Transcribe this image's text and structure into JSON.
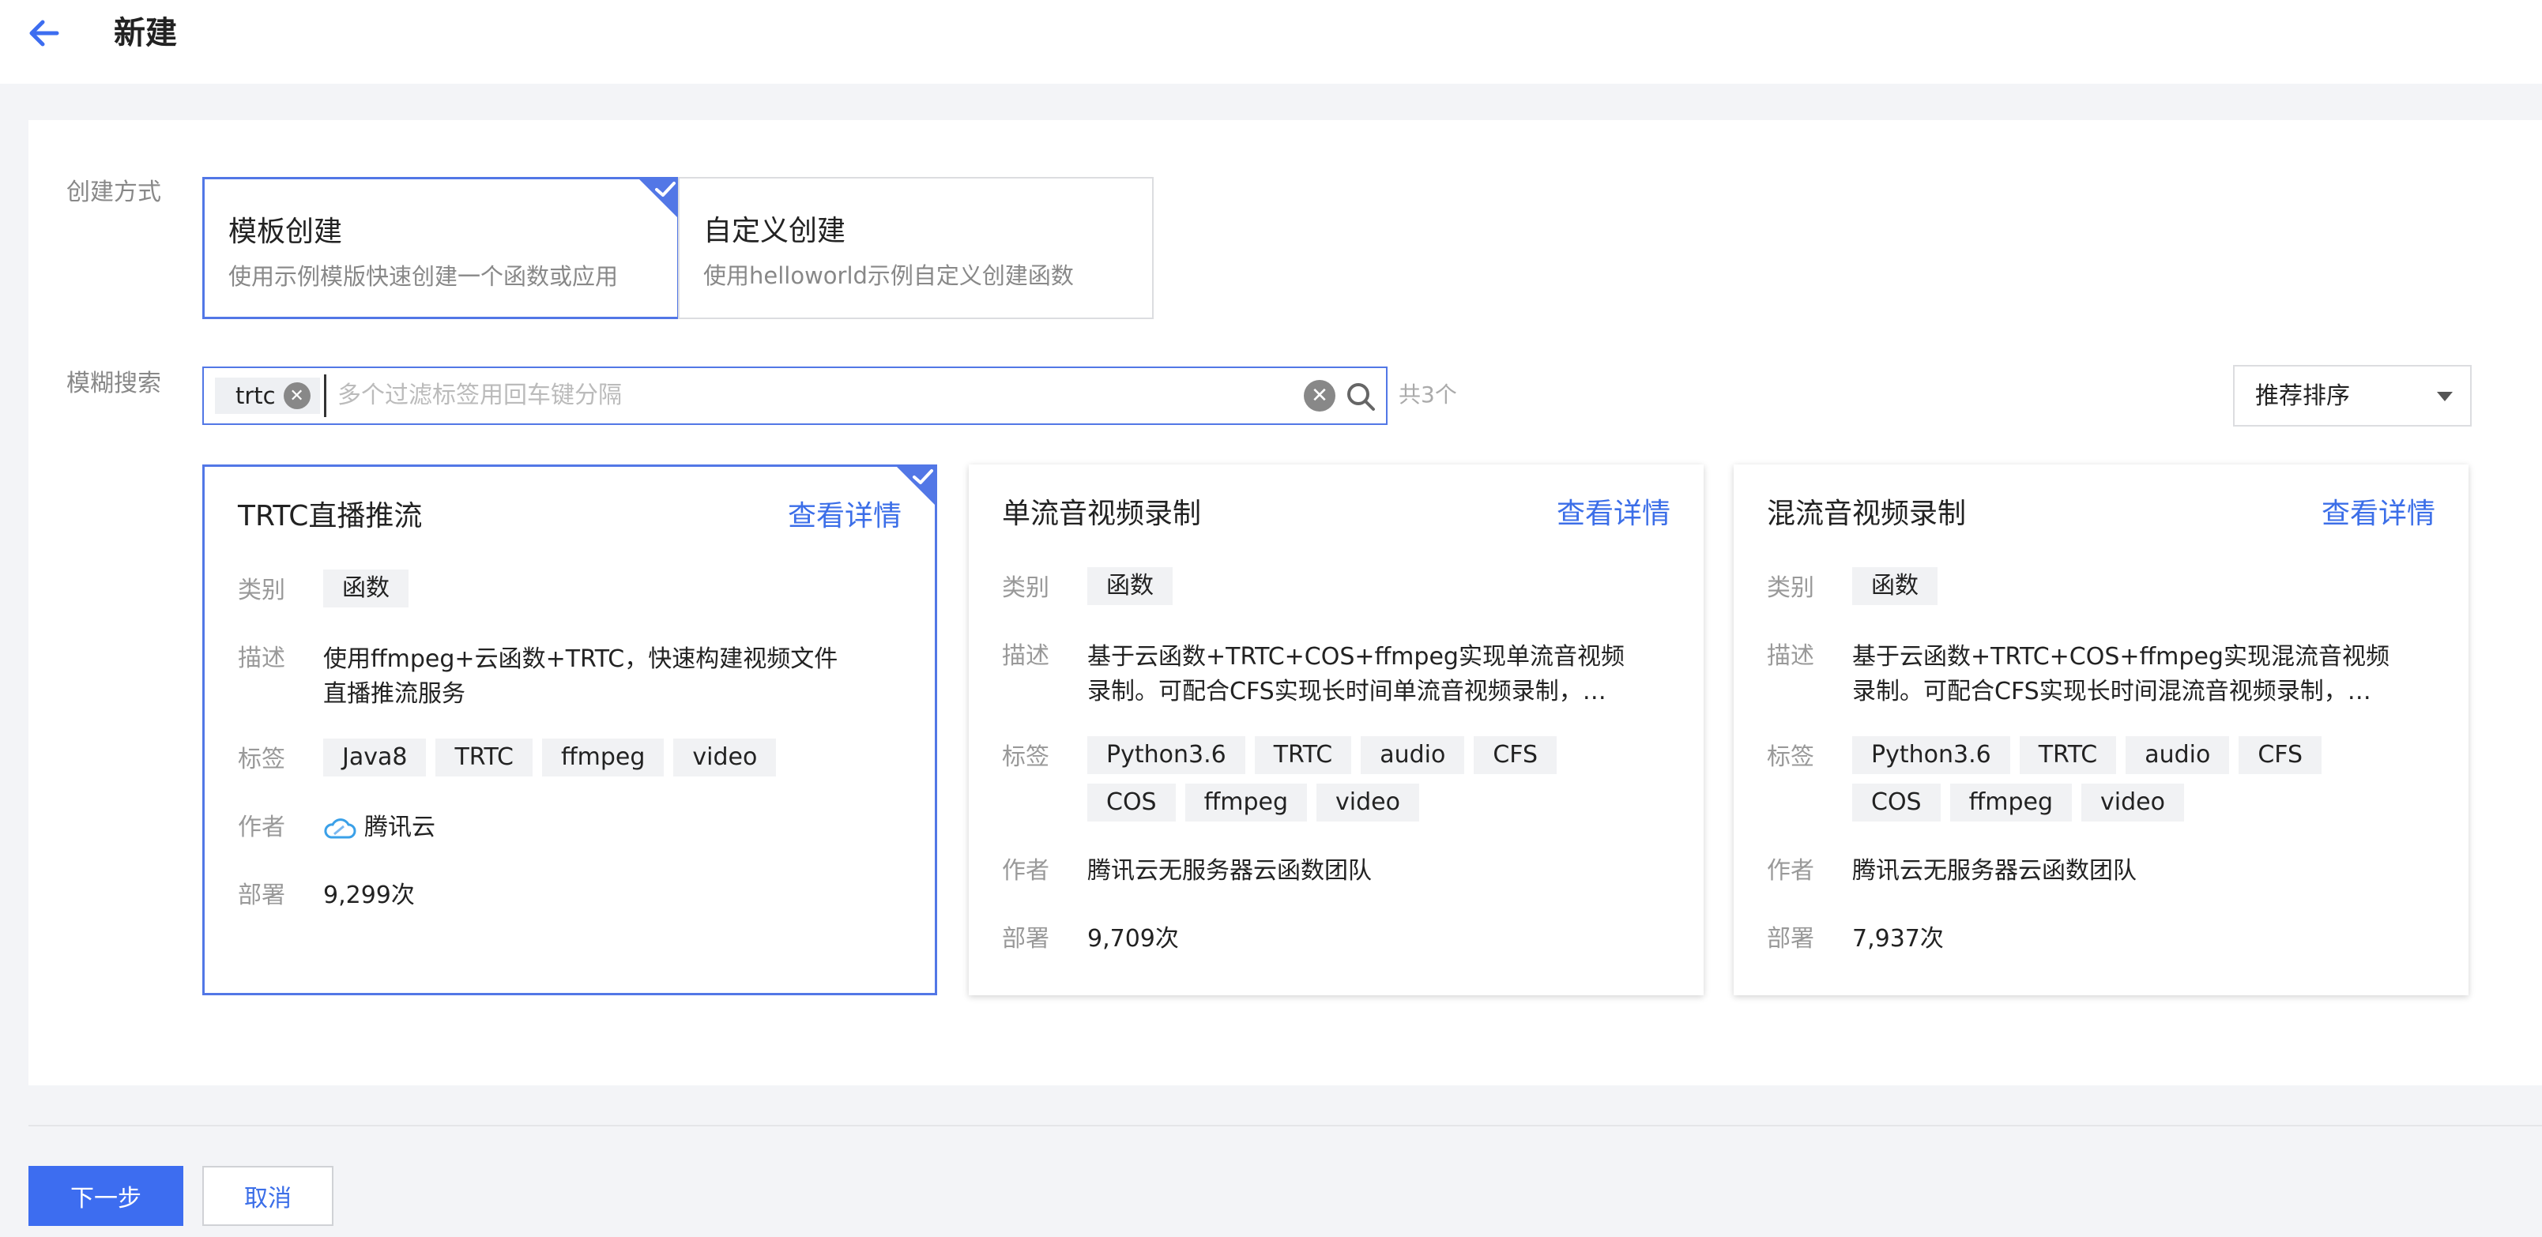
{
  "header": {
    "title": "新建"
  },
  "form": {
    "method_label": "创建方式",
    "search_label": "模糊搜索"
  },
  "methods": [
    {
      "title": "模板创建",
      "desc": "使用示例模版快速创建一个函数或应用",
      "selected": true
    },
    {
      "title": "自定义创建",
      "desc": "使用helloworld示例自定义创建函数",
      "selected": false
    }
  ],
  "search": {
    "chip": "trtc",
    "placeholder": "多个过滤标签用回车键分隔",
    "count": "共3个"
  },
  "sort": {
    "label": "推荐排序"
  },
  "labels": {
    "category": "类别",
    "desc": "描述",
    "tags": "标签",
    "author": "作者",
    "deploy": "部署",
    "detail": "查看详情"
  },
  "cards": [
    {
      "title": "TRTC直播推流",
      "category": "函数",
      "desc": "使用ffmpeg+云函数+TRTC，快速构建视频文件直播推流服务",
      "tags": [
        "Java8",
        "TRTC",
        "ffmpeg",
        "video"
      ],
      "author": "腾讯云",
      "deploy": "9,299次",
      "selected": true
    },
    {
      "title": "单流音视频录制",
      "category": "函数",
      "desc": "基于云函数+TRTC+COS+ffmpeg实现单流音视频录制。可配合CFS实现长时间单流音视频录制，…",
      "tags": [
        "Python3.6",
        "TRTC",
        "audio",
        "CFS",
        "COS",
        "ffmpeg",
        "video"
      ],
      "author": "腾讯云无服务器云函数团队",
      "deploy": "9,709次",
      "selected": false
    },
    {
      "title": "混流音视频录制",
      "category": "函数",
      "desc": "基于云函数+TRTC+COS+ffmpeg实现混流音视频录制。可配合CFS实现长时间混流音视频录制，…",
      "tags": [
        "Python3.6",
        "TRTC",
        "audio",
        "CFS",
        "COS",
        "ffmpeg",
        "video"
      ],
      "author": "腾讯云无服务器云函数团队",
      "deploy": "7,937次",
      "selected": false
    }
  ],
  "footer": {
    "next": "下一步",
    "cancel": "取消"
  },
  "colors": {
    "accent": "#3d6df0",
    "link": "#3b6ee8",
    "border_selected": "#5277e6"
  }
}
